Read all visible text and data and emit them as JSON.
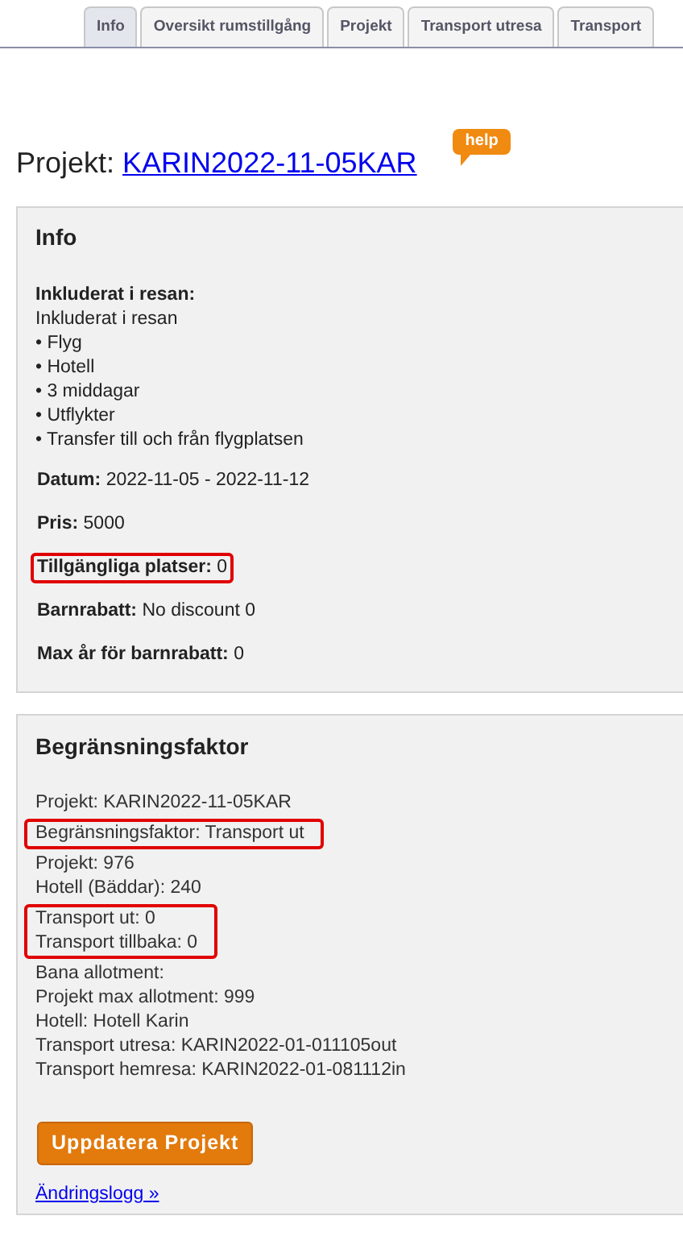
{
  "tabs": [
    {
      "label": "Info",
      "selected": true
    },
    {
      "label": "Oversikt rumstillgång",
      "selected": false
    },
    {
      "label": "Projekt",
      "selected": false
    },
    {
      "label": "Transport utresa",
      "selected": false
    },
    {
      "label": "Transport",
      "selected": false
    }
  ],
  "title": {
    "label": "Projekt:",
    "link": "KARIN2022-11-05KAR",
    "help": "help"
  },
  "info": {
    "heading": "Info",
    "included_label": "Inkluderat i resan:",
    "included_lines": [
      "Inkluderat i resan",
      "• Flyg",
      "• Hotell",
      "• 3 middagar",
      "• Utflykter",
      "• Transfer till och från flygplatsen"
    ],
    "fields": [
      {
        "label": "Datum:",
        "value": "2022-11-05 - 2022-11-12",
        "highlighted": false
      },
      {
        "label": "Pris:",
        "value": "5000",
        "highlighted": false
      },
      {
        "label": "Tillgängliga platser:",
        "value": "0",
        "highlighted": true
      },
      {
        "label": "Barnrabatt:",
        "value": "No discount 0",
        "highlighted": false
      },
      {
        "label": "Max år för barnrabatt:",
        "value": "0",
        "highlighted": false
      }
    ]
  },
  "limit": {
    "heading": "Begränsningsfaktor",
    "groups": [
      {
        "lines": [
          "Projekt: KARIN2022-11-05KAR"
        ],
        "highlighted": false
      },
      {
        "lines": [
          "Begränsningsfaktor: Transport ut"
        ],
        "highlighted": true
      },
      {
        "lines": [
          "Projekt: 976",
          "Hotell (Bäddar): 240"
        ],
        "highlighted": false
      },
      {
        "lines": [
          "Transport ut: 0",
          "Transport tillbaka: 0"
        ],
        "highlighted": true
      },
      {
        "lines": [
          "Bana allotment:",
          "Projekt max allotment: 999",
          "Hotell: Hotell Karin",
          "Transport utresa: KARIN2022-01-011105out",
          "Transport hemresa: KARIN2022-01-081112in"
        ],
        "highlighted": false
      }
    ],
    "button": "Uppdatera Projekt",
    "log_link": "Ändringslogg »"
  }
}
